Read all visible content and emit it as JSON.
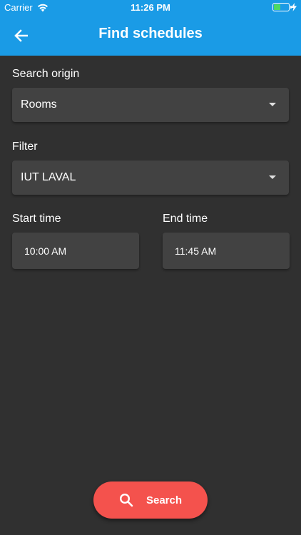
{
  "status_bar": {
    "carrier": "Carrier",
    "time": "11:26 PM",
    "icons": [
      "wifi-icon",
      "battery-icon",
      "charging-bolt-icon"
    ]
  },
  "app_bar": {
    "title": "Find schedules",
    "back_icon": "arrow-left-icon"
  },
  "form": {
    "search_origin": {
      "label": "Search origin",
      "value": "Rooms"
    },
    "filter": {
      "label": "Filter",
      "value": "IUT LAVAL"
    },
    "start_time": {
      "label": "Start time",
      "value": "10:00 AM"
    },
    "end_time": {
      "label": "End time",
      "value": "11:45 AM"
    }
  },
  "actions": {
    "search_label": "Search",
    "search_icon": "search-icon"
  },
  "colors": {
    "app_bar": "#1a9be6",
    "background": "#303030",
    "field": "#424242",
    "accent": "#f4524d",
    "battery": "#4cd964"
  }
}
